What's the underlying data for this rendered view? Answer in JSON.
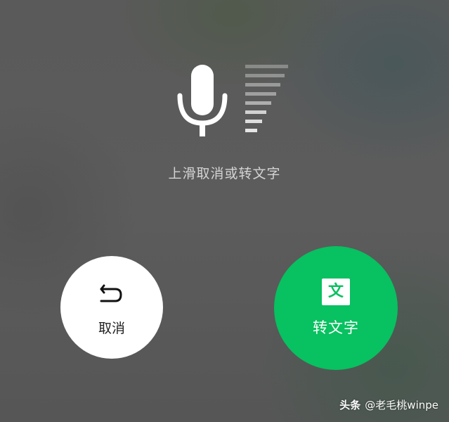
{
  "hint": "上滑取消或转文字",
  "cancel": {
    "label": "取消",
    "icon": "undo-arrow-icon"
  },
  "convert": {
    "label": "转文字",
    "icon_text": "文",
    "color": "#08c160"
  },
  "mic_icon": "microphone-icon",
  "volume_level": 1.0,
  "watermark": {
    "brand": "头条",
    "author": "@老毛桃winpe"
  }
}
